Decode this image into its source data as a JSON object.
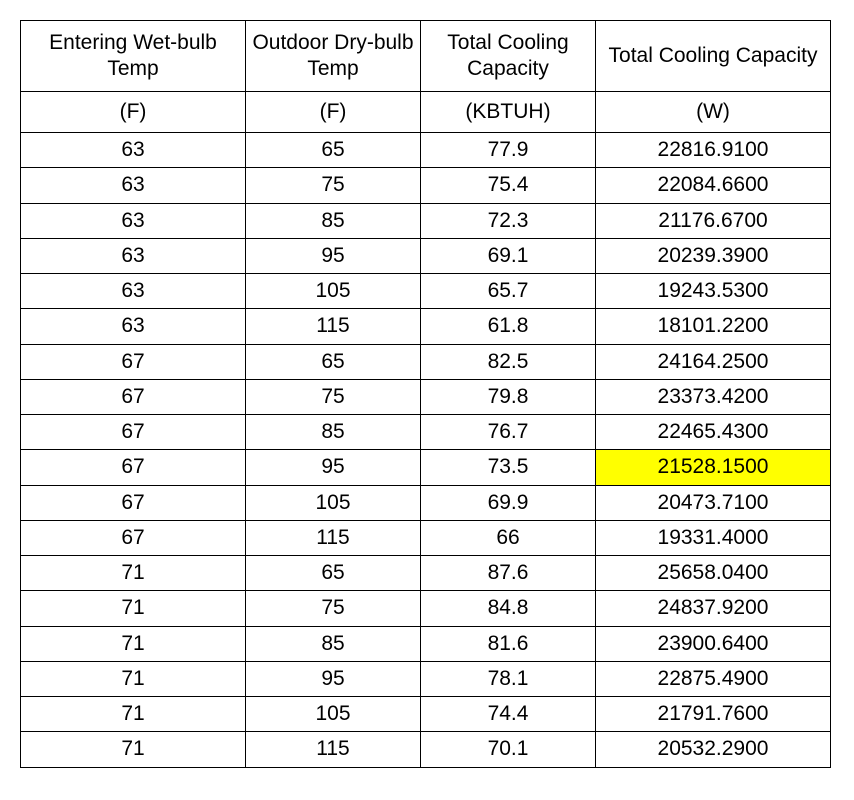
{
  "chart_data": {
    "type": "table",
    "title": "",
    "columns": [
      {
        "label": "Entering Wet-bulb Temp",
        "unit": "(F)"
      },
      {
        "label": "Outdoor Dry-bulb Temp",
        "unit": "(F)"
      },
      {
        "label": "Total Cooling Capacity",
        "unit": "(KBTUH)"
      },
      {
        "label": "Total Cooling Capacity",
        "unit": "(W)"
      }
    ],
    "rows": [
      {
        "c1": "63",
        "c2": "65",
        "c3": "77.9",
        "c4": "22816.9100",
        "hl": false
      },
      {
        "c1": "63",
        "c2": "75",
        "c3": "75.4",
        "c4": "22084.6600",
        "hl": false
      },
      {
        "c1": "63",
        "c2": "85",
        "c3": "72.3",
        "c4": "21176.6700",
        "hl": false
      },
      {
        "c1": "63",
        "c2": "95",
        "c3": "69.1",
        "c4": "20239.3900",
        "hl": false
      },
      {
        "c1": "63",
        "c2": "105",
        "c3": "65.7",
        "c4": "19243.5300",
        "hl": false
      },
      {
        "c1": "63",
        "c2": "115",
        "c3": "61.8",
        "c4": "18101.2200",
        "hl": false
      },
      {
        "c1": "67",
        "c2": "65",
        "c3": "82.5",
        "c4": "24164.2500",
        "hl": false
      },
      {
        "c1": "67",
        "c2": "75",
        "c3": "79.8",
        "c4": "23373.4200",
        "hl": false
      },
      {
        "c1": "67",
        "c2": "85",
        "c3": "76.7",
        "c4": "22465.4300",
        "hl": false
      },
      {
        "c1": "67",
        "c2": "95",
        "c3": "73.5",
        "c4": "21528.1500",
        "hl": true
      },
      {
        "c1": "67",
        "c2": "105",
        "c3": "69.9",
        "c4": "20473.7100",
        "hl": false
      },
      {
        "c1": "67",
        "c2": "115",
        "c3": "66",
        "c4": "19331.4000",
        "hl": false
      },
      {
        "c1": "71",
        "c2": "65",
        "c3": "87.6",
        "c4": "25658.0400",
        "hl": false
      },
      {
        "c1": "71",
        "c2": "75",
        "c3": "84.8",
        "c4": "24837.9200",
        "hl": false
      },
      {
        "c1": "71",
        "c2": "85",
        "c3": "81.6",
        "c4": "23900.6400",
        "hl": false
      },
      {
        "c1": "71",
        "c2": "95",
        "c3": "78.1",
        "c4": "22875.4900",
        "hl": false
      },
      {
        "c1": "71",
        "c2": "105",
        "c3": "74.4",
        "c4": "21791.7600",
        "hl": false
      },
      {
        "c1": "71",
        "c2": "115",
        "c3": "70.1",
        "c4": "20532.2900",
        "hl": false
      }
    ]
  }
}
